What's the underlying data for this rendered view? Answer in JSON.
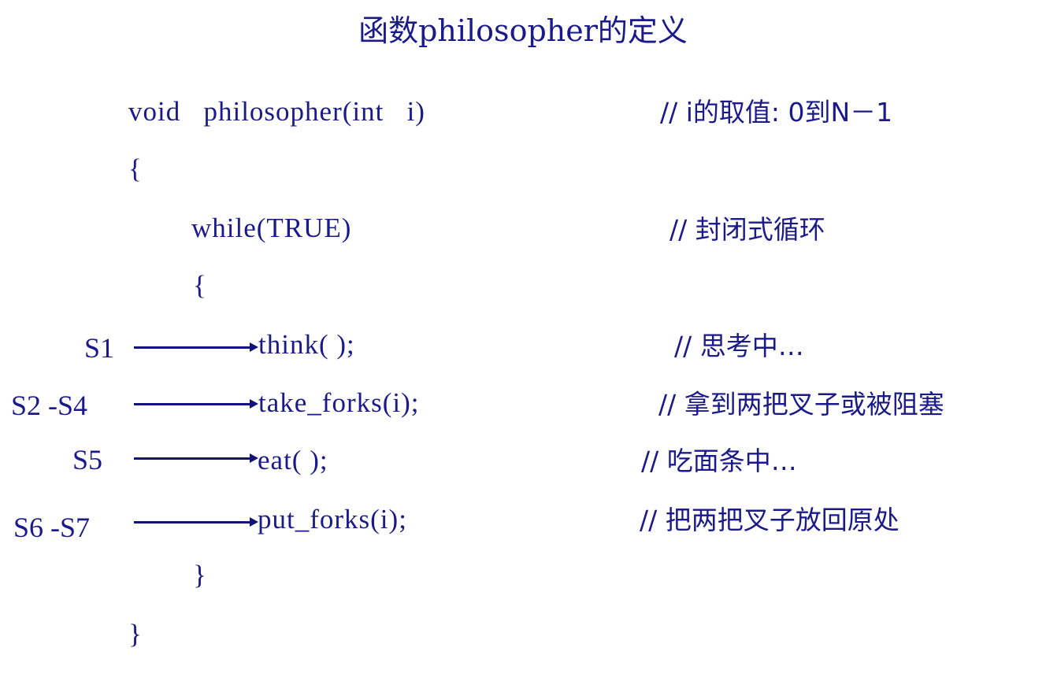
{
  "title": "函数philosopher的定义",
  "code": {
    "signature": "void   philosopher(int   i)",
    "open_brace_outer": "{",
    "while_line": "while(TRUE)",
    "open_brace_inner": "{",
    "think": "think( );",
    "take_forks": "take_forks(i);",
    "eat": "eat( );",
    "put_forks": "put_forks(i);",
    "close_brace_inner": "}",
    "close_brace_outer": "}"
  },
  "comments": {
    "signature": "// i的取值: 0到N－1",
    "while": "// 封闭式循环",
    "think": "// 思考中…",
    "take_forks": "// 拿到两把叉子或被阻塞",
    "eat": "// 吃面条中…",
    "put_forks": "// 把两把叉子放回原处"
  },
  "steps": {
    "think": "S1",
    "take_forks": "S2 -S4",
    "eat": "S5",
    "put_forks": "S6 -S7"
  },
  "colors": {
    "text": "#1a1a8a",
    "arrow": "#121279",
    "background": "#ffffff"
  }
}
